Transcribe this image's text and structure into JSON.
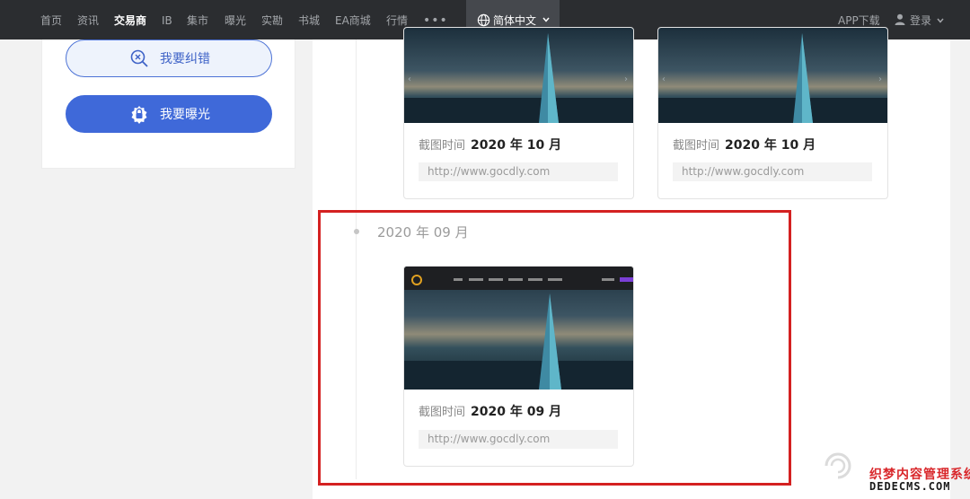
{
  "nav": {
    "items": [
      "首页",
      "资讯",
      "交易商",
      "IB",
      "集市",
      "曝光",
      "实勘",
      "书城",
      "EA商城",
      "行情"
    ],
    "more": "•••",
    "language": "简体中文",
    "app_download": "APP下载",
    "login": "登录"
  },
  "sidebar": {
    "correct_button": "我要纠错",
    "expose_button": "我要曝光"
  },
  "timeline": {
    "caption_label": "截图时间",
    "prev_cards": [
      {
        "date": "2020 年 10 月",
        "url": "http://www.gocdly.com"
      },
      {
        "date": "2020 年 10 月",
        "url": "http://www.gocdly.com"
      }
    ],
    "section": {
      "title": "2020 年 09 月",
      "card": {
        "date": "2020 年 09 月",
        "url": "http://www.gocdly.com"
      }
    }
  },
  "watermark": {
    "line1": "织梦内容管理系统",
    "line2": "DEDECMS.COM"
  },
  "colors": {
    "nav_bg": "#2b2d30",
    "accent_blue": "#3f69d9",
    "highlight_red": "#d42121"
  }
}
